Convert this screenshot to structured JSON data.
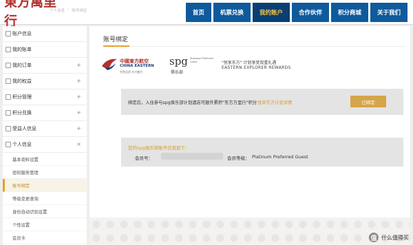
{
  "header": {
    "logo_text": "東方萬里行",
    "logo_sub": "",
    "breadcrumb": [
      "个人信息",
      "账号绑定"
    ],
    "nav": [
      {
        "label": "首页",
        "active": false
      },
      {
        "label": "机票兑换",
        "active": false
      },
      {
        "label": "我的账户",
        "active": true
      },
      {
        "label": "合作伙伴",
        "active": false
      },
      {
        "label": "积分商城",
        "active": false
      },
      {
        "label": "关于我们",
        "active": false
      }
    ]
  },
  "sidebar": {
    "items": [
      {
        "label": "账户信息",
        "toggle": ""
      },
      {
        "label": "我的账单",
        "toggle": ""
      },
      {
        "label": "我的订单",
        "toggle": "+"
      },
      {
        "label": "我的权益",
        "toggle": "+"
      },
      {
        "label": "积分管理",
        "toggle": "+"
      },
      {
        "label": "积分兑换",
        "toggle": "+"
      },
      {
        "label": "受益人信息",
        "toggle": "+"
      },
      {
        "label": "个人信息",
        "toggle": "×"
      }
    ],
    "sub_items": [
      {
        "label": "基本资料设置",
        "active": false
      },
      {
        "label": "密码服务管理",
        "active": false
      },
      {
        "label": "账号绑定",
        "active": true
      },
      {
        "label": "等级变更查询",
        "active": false
      },
      {
        "label": "身份自动识别设置",
        "active": false
      },
      {
        "label": "个性设置",
        "active": false
      },
      {
        "label": "会员卡",
        "active": false
      }
    ]
  },
  "main": {
    "title": "账号绑定",
    "china_eastern": {
      "cn": "中國東方航空",
      "en": "CHINA EASTERN",
      "tag": "世界品质 东方魅力"
    },
    "spg": {
      "big": "spg",
      "cn": "俱乐部",
      "small": "Starwood Preferred Guest"
    },
    "reward_cn": "\"悦享东方\" 计划享受双重礼遇",
    "reward_en": "EASTERN EXPLORER REWARDS",
    "bind_text": "绑定后，入住参与spg俱乐部计划酒店可额外累积\"东方万里行\"积分",
    "bind_link": "悦享东方计划详情",
    "bind_button": "已绑定",
    "info_head": "您的spg俱乐部账号信息如下：",
    "member_no_label": "会员号：",
    "member_level_label": "会员等级：",
    "member_level_value": "Platinum Preferred Guest"
  },
  "watermark": {
    "icon": "值",
    "text": "什么值得买"
  },
  "colors": {
    "nav_blue": "#0e5a9c",
    "nav_active": "#0a3f73",
    "accent_gold": "#d59d2b",
    "brand_red": "#b0322f"
  }
}
